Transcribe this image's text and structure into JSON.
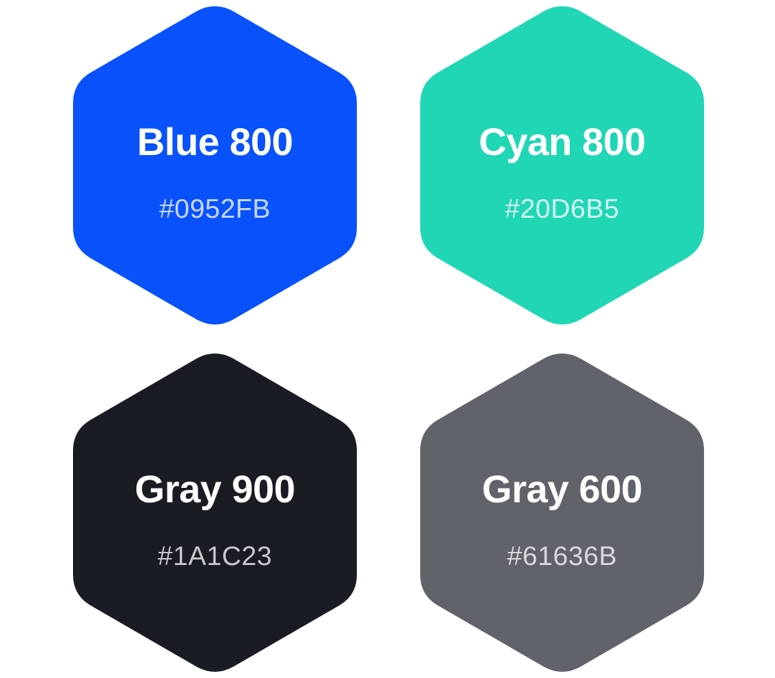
{
  "swatches": [
    {
      "name": "Blue 800",
      "hex_label": "#0952FB",
      "fill": "#0952FB",
      "code_color": "#c9d8fe"
    },
    {
      "name": "Cyan 800",
      "hex_label": "#20D6B5",
      "fill": "#20D6B5",
      "code_color": "#d6f6f0"
    },
    {
      "name": "Gray 900",
      "hex_label": "#1A1C23",
      "fill": "#1A1C23",
      "code_color": "#c6c7c9"
    },
    {
      "name": "Gray 600",
      "hex_label": "#61636B",
      "fill": "#61636B",
      "code_color": "#d7d8da"
    }
  ]
}
